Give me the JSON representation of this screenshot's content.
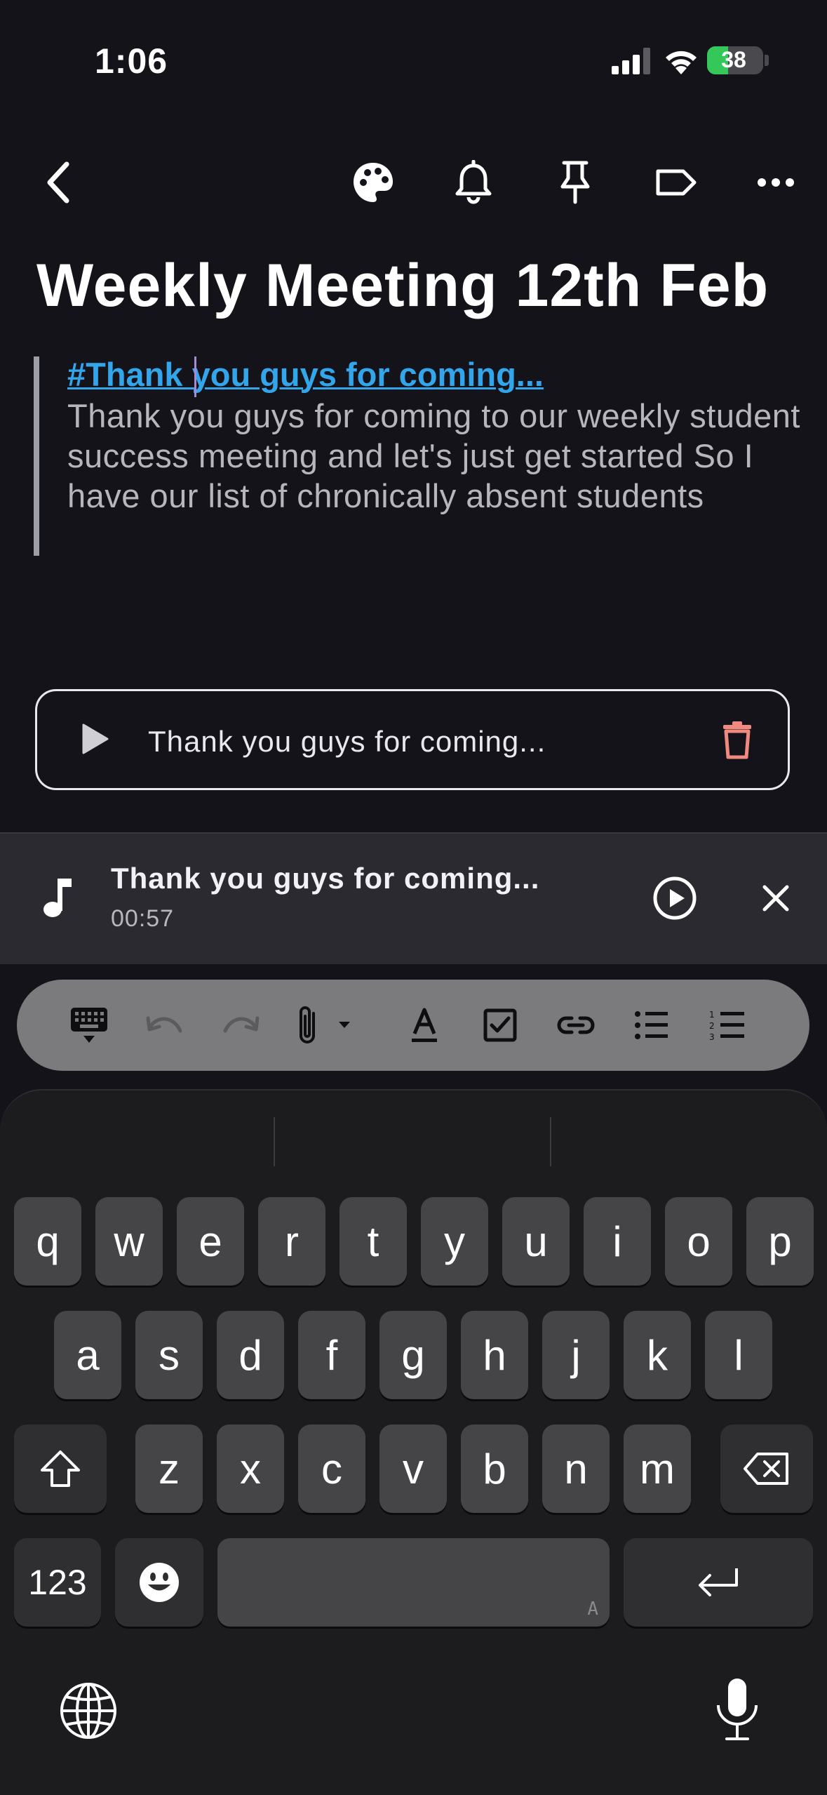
{
  "status_bar": {
    "time": "1:06",
    "battery_percent": "38",
    "battery_level": 0.38,
    "signal_bars_active": 3
  },
  "toolbar": {
    "icons": [
      "back-chevron-icon",
      "palette-icon",
      "bell-icon",
      "pin-icon",
      "label-icon",
      "more-icon"
    ]
  },
  "note": {
    "title": "Weekly Meeting 12th Feb",
    "hashtag_link": "#Thank you guys for coming...",
    "body": "Thank you guys for coming to our weekly student success meeting and let's just get started So I have our list of chronically absent students"
  },
  "audio_attachment": {
    "label": "Thank you guys for coming..."
  },
  "now_playing": {
    "title": "Thank you guys for coming...",
    "time": "00:57"
  },
  "format_toolbar": {
    "icons": [
      "keyboard-hide-icon",
      "undo-icon",
      "redo-icon",
      "attach-icon",
      "text-color-icon",
      "checkbox-icon",
      "link-icon",
      "bullet-list-icon",
      "numbered-list-icon"
    ]
  },
  "keyboard": {
    "row1": [
      "q",
      "w",
      "e",
      "r",
      "t",
      "y",
      "u",
      "i",
      "o",
      "p"
    ],
    "row2": [
      "a",
      "s",
      "d",
      "f",
      "g",
      "h",
      "j",
      "k",
      "l"
    ],
    "row3": [
      "z",
      "x",
      "c",
      "v",
      "b",
      "n",
      "m"
    ],
    "numbers_key": "123",
    "space_mark": "A"
  },
  "colors": {
    "background": "#14131a",
    "link": "#33a5ea",
    "delete": "#f08a80",
    "battery": "#34c759"
  }
}
